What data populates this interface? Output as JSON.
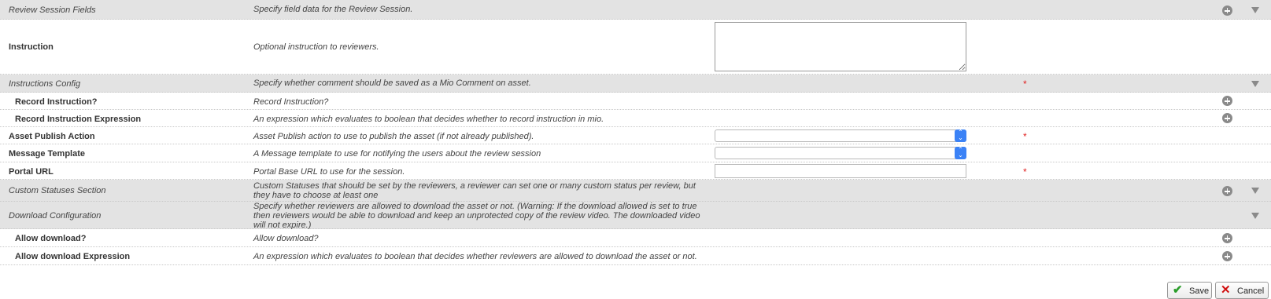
{
  "rows": {
    "review_session_fields": {
      "label": "Review Session Fields",
      "description": "Specify field data for the Review Session."
    },
    "instruction": {
      "label": "Instruction",
      "description": "Optional instruction to reviewers.",
      "value": ""
    },
    "instructions_config": {
      "label": "Instructions Config",
      "description": "Specify whether comment should be saved as a Mio Comment on asset.",
      "required_mark": "*"
    },
    "record_instruction": {
      "label": "Record Instruction?",
      "description": "Record Instruction?"
    },
    "record_instruction_expression": {
      "label": "Record Instruction Expression",
      "description": "An expression which evaluates to boolean that decides whether to record instruction in mio."
    },
    "asset_publish_action": {
      "label": "Asset Publish Action",
      "description": "Asset Publish action to use to publish the asset (if not already published).",
      "value": "",
      "required_mark": "*"
    },
    "message_template": {
      "label": "Message Template",
      "description": "A Message template to use for notifying the users about the review session",
      "value": ""
    },
    "portal_url": {
      "label": "Portal URL",
      "description": "Portal Base URL to use for the session.",
      "value": "",
      "required_mark": "*"
    },
    "custom_statuses_section": {
      "label": "Custom Statuses Section",
      "description": "Custom Statuses that should be set by the reviewers, a reviewer can set one or many custom status per review, but they have to choose at least one"
    },
    "download_configuration": {
      "label": "Download Configuration",
      "description": "Specify whether reviewers are allowed to download the asset or not. (Warning: If the download allowed is set to true then reviewers would be able to download and keep an unprotected copy of the review video. The downloaded video will not expire.)"
    },
    "allow_download": {
      "label": "Allow download?",
      "description": "Allow download?"
    },
    "allow_download_expression": {
      "label": "Allow download Expression",
      "description": "An expression which evaluates to boolean that decides whether reviewers are allowed to download the asset or not."
    }
  },
  "buttons": {
    "save": "Save",
    "cancel": "Cancel"
  },
  "icons": {
    "add": "plus-circle-icon",
    "collapse": "triangle-down-icon",
    "save": "checkmark-icon",
    "cancel": "x-icon"
  },
  "colors": {
    "section_bg": "#e3e3e3",
    "required": "#e02020",
    "select_accent": "#3b82f6",
    "save_check": "#2a9d2a",
    "cancel_x": "#d01010"
  }
}
